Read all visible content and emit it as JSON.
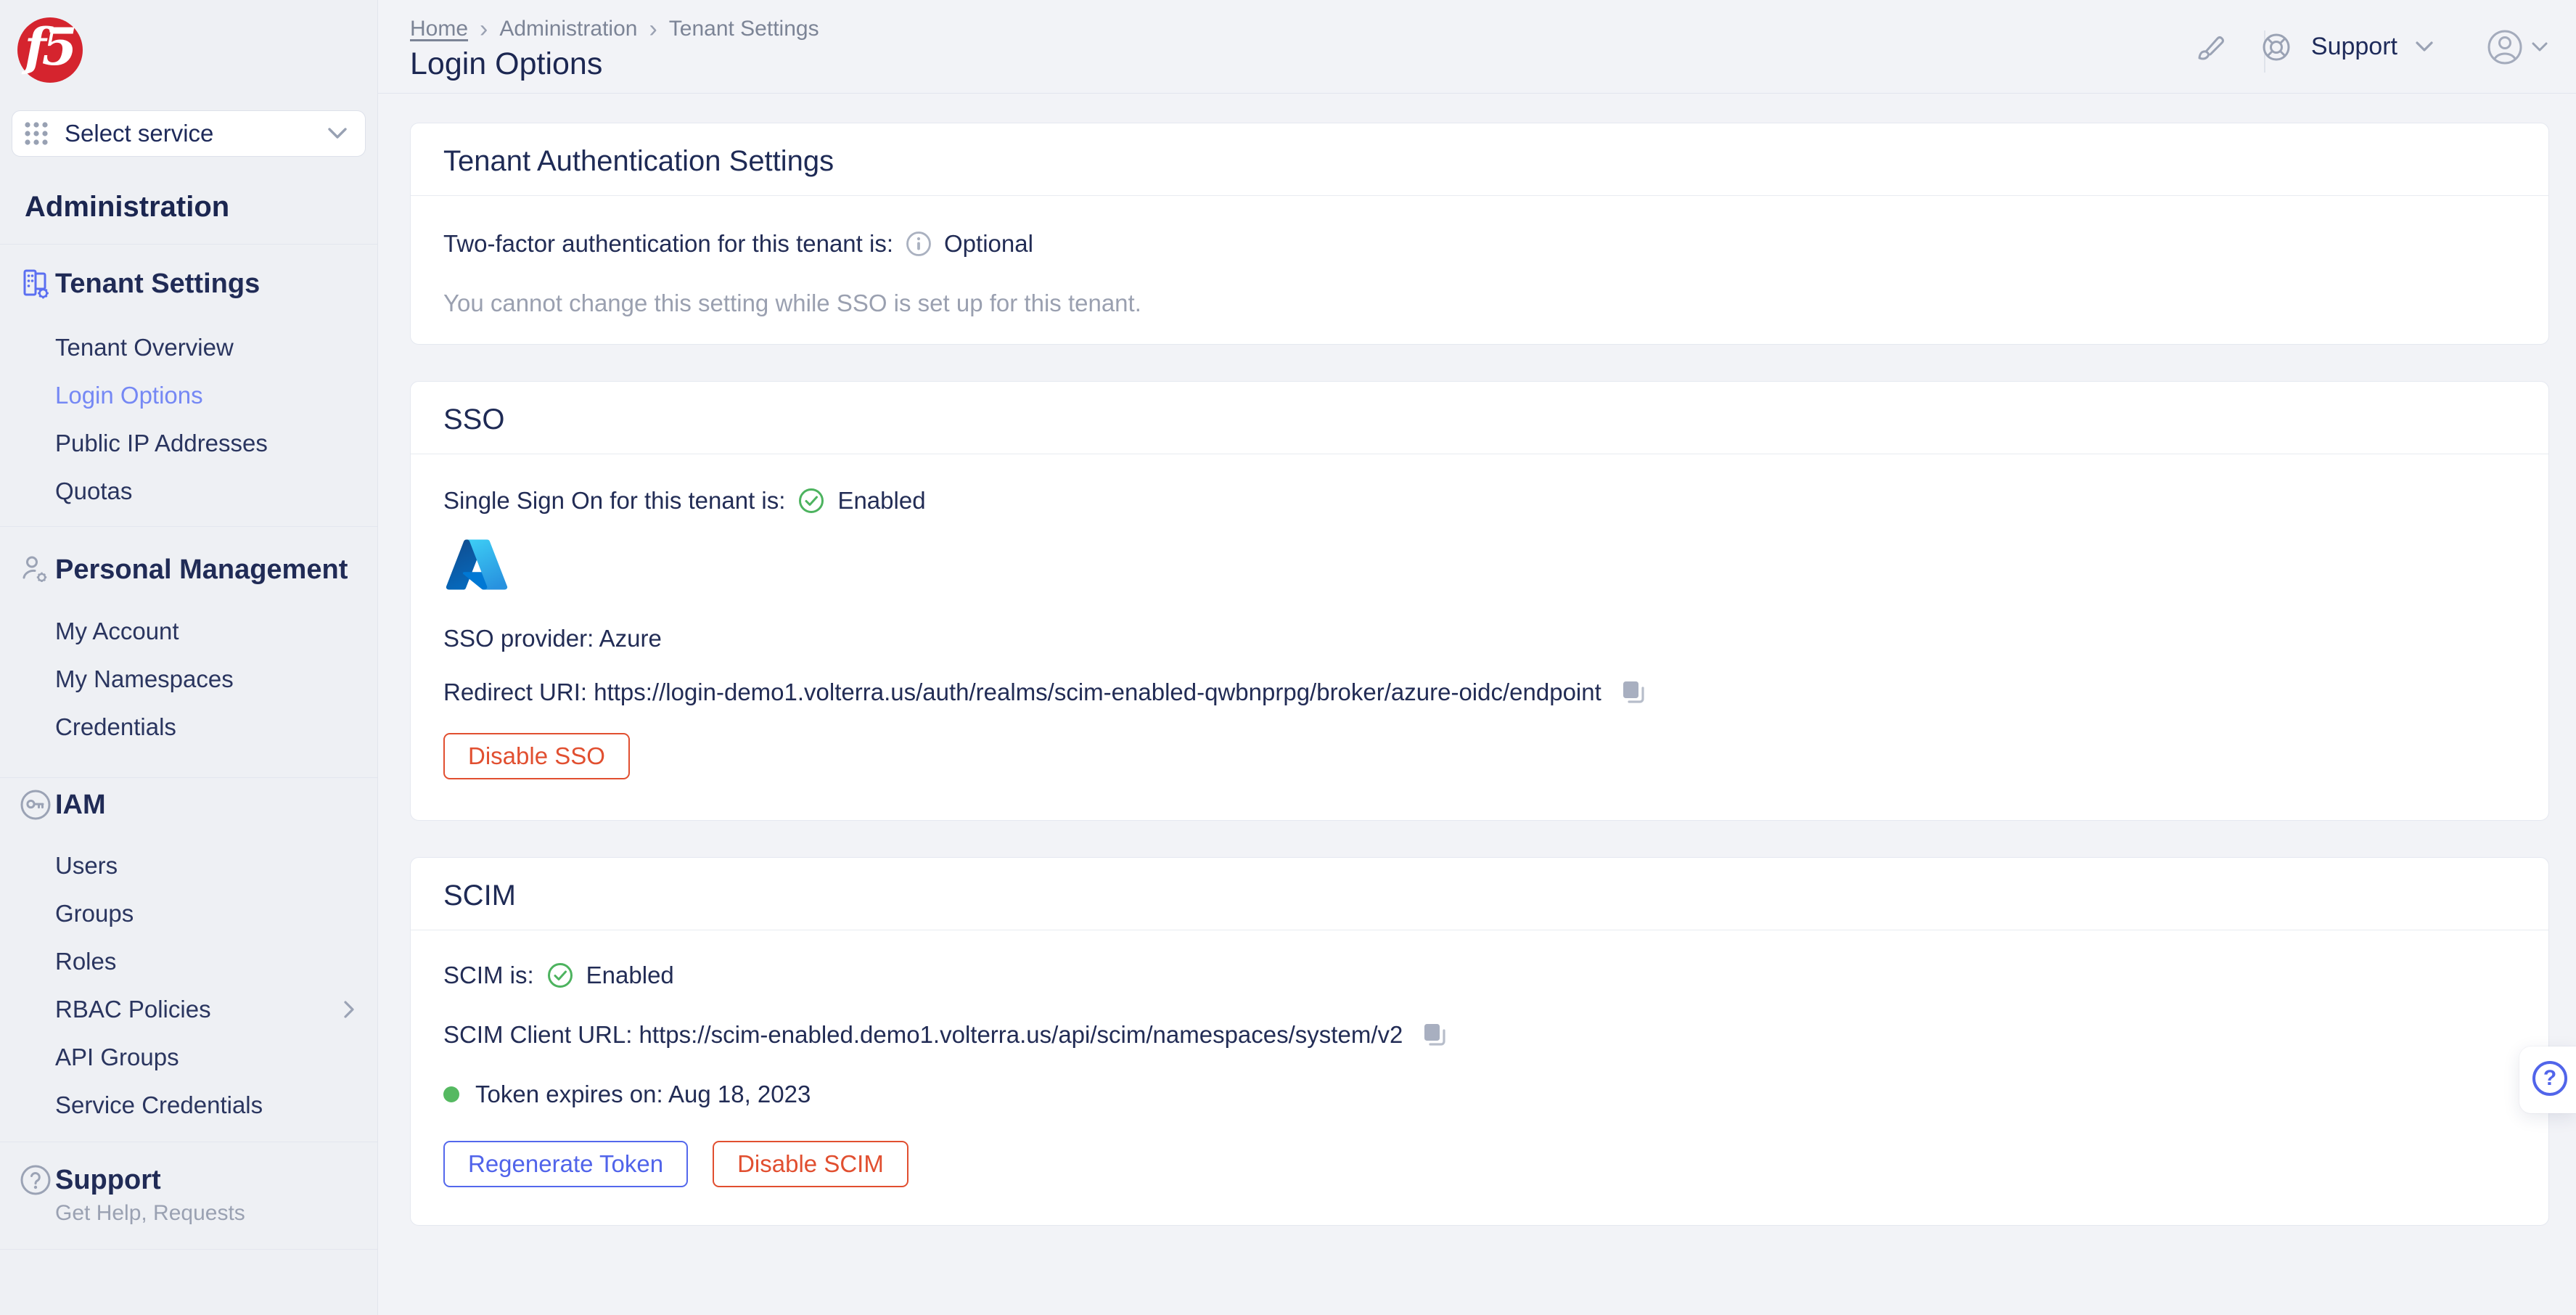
{
  "brand": {
    "logo_text": "f5"
  },
  "sidebar": {
    "select_service": "Select service",
    "section_title": "Administration",
    "groups": [
      {
        "title": "Tenant Settings",
        "icon": "building-gear-icon",
        "items": [
          {
            "label": "Tenant Overview",
            "active": false
          },
          {
            "label": "Login Options",
            "active": true
          },
          {
            "label": "Public IP Addresses",
            "active": false
          },
          {
            "label": "Quotas",
            "active": false
          }
        ]
      },
      {
        "title": "Personal Management",
        "icon": "person-gear-icon",
        "items": [
          {
            "label": "My Account"
          },
          {
            "label": "My Namespaces"
          },
          {
            "label": "Credentials"
          }
        ]
      },
      {
        "title": "IAM",
        "icon": "key-icon",
        "items": [
          {
            "label": "Users"
          },
          {
            "label": "Groups"
          },
          {
            "label": "Roles"
          },
          {
            "label": "RBAC Policies",
            "has_submenu": true
          },
          {
            "label": "API Groups"
          },
          {
            "label": "Service Credentials"
          }
        ]
      }
    ],
    "support": {
      "title": "Support",
      "subtitle": "Get Help, Requests"
    }
  },
  "header": {
    "breadcrumbs": [
      {
        "label": "Home"
      },
      {
        "label": "Administration"
      },
      {
        "label": "Tenant Settings"
      }
    ],
    "page_title": "Login Options",
    "support_label": "Support"
  },
  "cards": {
    "tenant_auth": {
      "title": "Tenant Authentication Settings",
      "two_factor_label": "Two-factor authentication for this tenant is:",
      "two_factor_value": "Optional",
      "note": "You cannot change this setting while SSO is set up for this tenant."
    },
    "sso": {
      "title": "SSO",
      "status_label": "Single Sign On for this tenant is:",
      "status_value": "Enabled",
      "provider": "SSO provider: Azure",
      "redirect_uri": "Redirect URI: https://login-demo1.volterra.us/auth/realms/scim-enabled-qwbnprpg/broker/azure-oidc/endpoint",
      "disable_label": "Disable SSO"
    },
    "scim": {
      "title": "SCIM",
      "status_label": "SCIM is:",
      "status_value": "Enabled",
      "client_url": "SCIM Client URL: https://scim-enabled.demo1.volterra.us/api/scim/namespaces/system/v2",
      "token_expiry": "Token expires on: Aug 18, 2023",
      "regenerate_label": "Regenerate Token",
      "disable_label": "Disable SCIM"
    }
  },
  "icons": {
    "breadcrumb_separator": "›",
    "help_glyph": "?"
  },
  "colors": {
    "brand_red": "#d5242e",
    "accent_blue": "#5468ec",
    "active_link_blue": "#7588f4",
    "danger_red": "#e14f30",
    "success_green": "#4db35f",
    "navy_text": "#1e2a5a"
  }
}
